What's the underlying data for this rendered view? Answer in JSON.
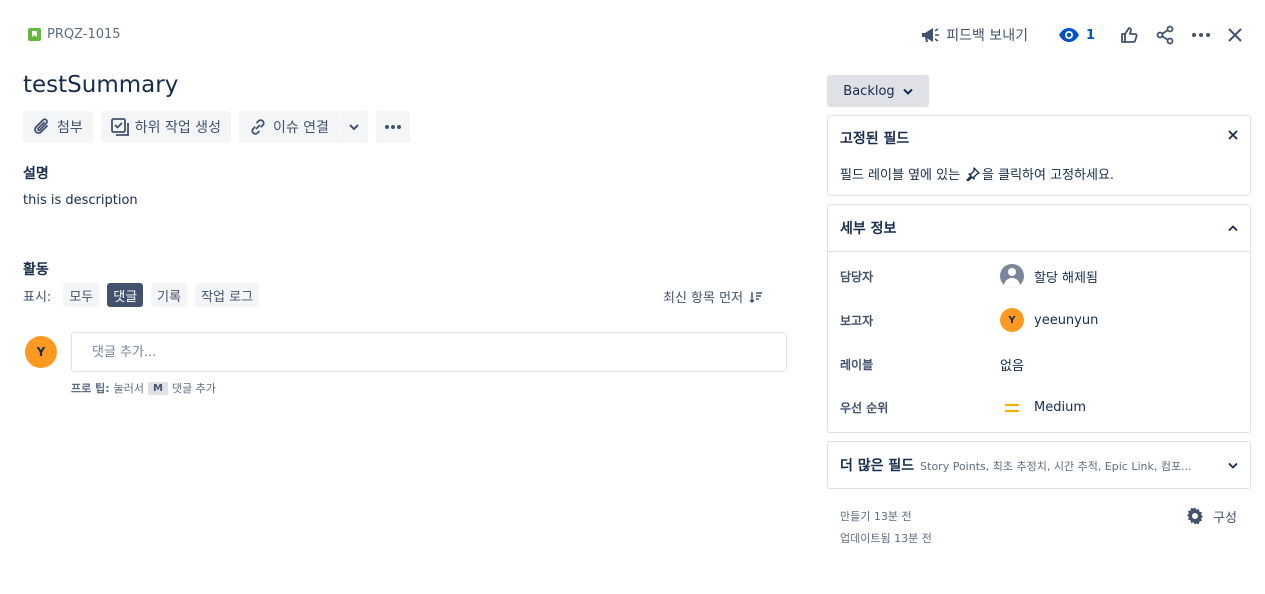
{
  "issue": {
    "key": "PRQZ-1015",
    "title": "testSummary"
  },
  "header": {
    "feedback_label": "피드백 보내기",
    "watch_count": "1"
  },
  "toolbar": {
    "attach_label": "첨부",
    "subtask_label": "하위 작업 생성",
    "link_label": "이슈 연결"
  },
  "description": {
    "label": "설명",
    "text": "this is description"
  },
  "activity": {
    "label": "활동",
    "show_label": "표시:",
    "filters": [
      "모두",
      "댓글",
      "기록",
      "작업 로그"
    ],
    "active_filter": "댓글",
    "sort_label": "최신 항목 먼저",
    "avatar_initial": "Y",
    "comment_placeholder": "댓글 추가...",
    "tip_prefix": "프로 팁:",
    "tip_middle": "눌러서",
    "tip_key": "M",
    "tip_suffix": "댓글 추가"
  },
  "sidebar": {
    "status": "Backlog",
    "pinned": {
      "title": "고정된 필드",
      "hint_before": "필드 레이블 옆에 있는",
      "hint_after": "을 클릭하여 고정하세요."
    },
    "details": {
      "title": "세부 정보",
      "rows": [
        {
          "label": "담당자",
          "value": "할당 해제됨"
        },
        {
          "label": "보고자",
          "value": "yeeunyun",
          "initial": "Y"
        },
        {
          "label": "레이블",
          "value": "없음"
        },
        {
          "label": "우선 순위",
          "value": "Medium"
        }
      ]
    },
    "more_fields": {
      "title": "더 많은 필드",
      "summary": "Story Points, 최초 추정치, 시간 추적, Epic Link, 컴포..."
    },
    "created": "만들기 13분 전",
    "updated": "업데이트됨 13분 전",
    "configure_label": "구성"
  },
  "colors": {
    "accent": "#0052cc",
    "story": "#63ba3c",
    "avatar": "#ff991f",
    "priority_medium": "#ffab00"
  }
}
